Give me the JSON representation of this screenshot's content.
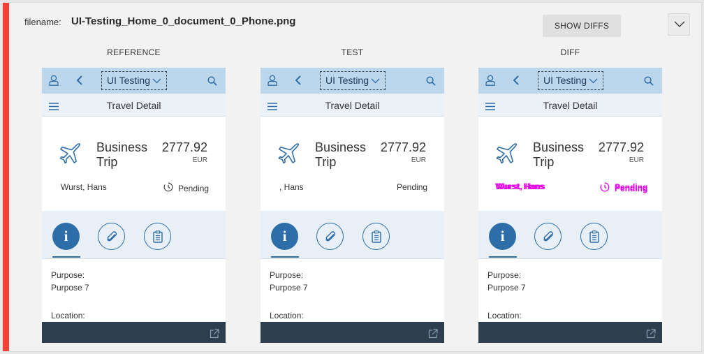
{
  "header": {
    "filename_label": "filename:",
    "filename_value": "UI-Testing_Home_0_document_0_Phone.png",
    "show_diffs_label": "SHOW DIFFS",
    "toggle_icon": "chevron-down-icon"
  },
  "colors": {
    "accent": "#f44336",
    "shell_bar": "#bcd6ec",
    "brand_blue": "#2d6da8",
    "footer": "#2d3e4e",
    "diff_highlight": "#e600e6"
  },
  "panels": [
    {
      "label": "REFERENCE",
      "title": "UI Testing",
      "subtitle": "Travel Detail",
      "trip_line1": "Business",
      "trip_line2": "Trip",
      "amount": "2777.92",
      "currency": "EUR",
      "name": "Wurst, Hans",
      "status": "Pending",
      "purpose_label": "Purpose:",
      "purpose_value": "Purpose 7",
      "location_label": "Location:"
    },
    {
      "label": "TEST",
      "title": "UI Testing",
      "subtitle": "Travel Detail",
      "trip_line1": "Business",
      "trip_line2": "Trip",
      "amount": "2777.92",
      "currency": "EUR",
      "name": ", Hans",
      "status": "Pending",
      "purpose_label": "Purpose:",
      "purpose_value": "Purpose 7",
      "location_label": "Location:"
    },
    {
      "label": "DIFF",
      "title": "UI Testing",
      "subtitle": "Travel Detail",
      "trip_line1": "Business",
      "trip_line2": "Trip",
      "amount": "2777.92",
      "currency": "EUR",
      "name": "Wurst, Hans",
      "status": "Pending",
      "purpose_label": "Purpose:",
      "purpose_value": "Purpose 7",
      "location_label": "Location:"
    }
  ]
}
